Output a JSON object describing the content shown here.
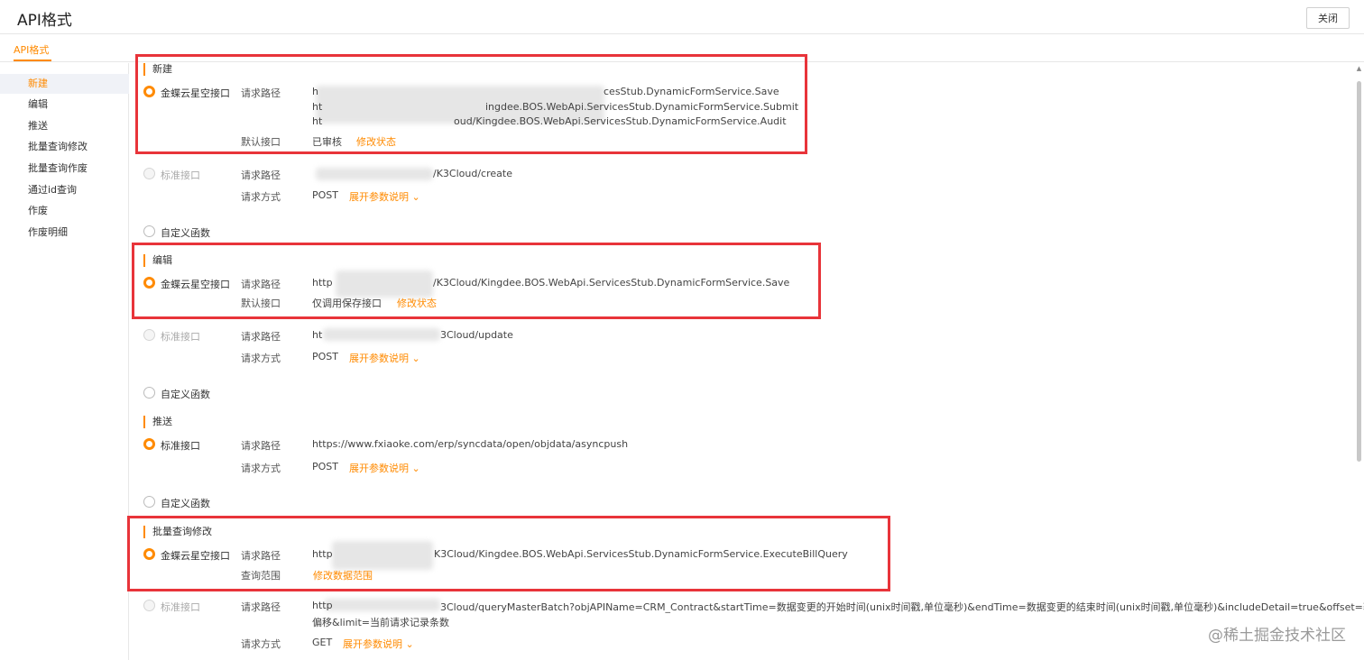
{
  "window": {
    "title": "API格式",
    "close_label": "关闭"
  },
  "tabs": [
    {
      "label": "API格式"
    }
  ],
  "sidebar": {
    "items": [
      "新建",
      "编辑",
      "推送",
      "批量查询修改",
      "批量查询作废",
      "通过id查询",
      "作废",
      "作废明细"
    ]
  },
  "labels": {
    "request_path": "请求路径",
    "default_interface": "默认接口",
    "request_method": "请求方式",
    "query_range": "查询范围",
    "modify_status": "修改状态",
    "modify_data_range": "修改数据范围",
    "expand_params": "展开参数说明",
    "custom_function": "自定义函数"
  },
  "sections": {
    "create": {
      "title": "新建",
      "kingdee_label": "金蝶云星空接口",
      "kingdee_paths": [
        "h",
        "cesStub.DynamicFormService.Save",
        "ht",
        "ingdee.BOS.WebApi.ServicesStub.DynamicFormService.Submit",
        "ht",
        "oud/Kingdee.BOS.WebApi.ServicesStub.DynamicFormService.Audit"
      ],
      "default_value": "已审核",
      "standard_label": "标准接口",
      "standard_path": "/K3Cloud/create",
      "method": "POST"
    },
    "edit": {
      "title": "编辑",
      "kingdee_label": "金蝶云星空接口",
      "kingdee_path_prefix": "http",
      "kingdee_path": "/K3Cloud/Kingdee.BOS.WebApi.ServicesStub.DynamicFormService.Save",
      "default_value": "仅调用保存接口",
      "standard_label": "标准接口",
      "standard_path_prefix": "ht",
      "standard_path": "3Cloud/update",
      "method": "POST"
    },
    "push": {
      "title": "推送",
      "standard_label": "标准接口",
      "standard_path": "https://www.fxiaoke.com/erp/syncdata/open/objdata/asyncpush",
      "method": "POST"
    },
    "batch_query": {
      "title": "批量查询修改",
      "kingdee_label": "金蝶云星空接口",
      "kingdee_path_prefix": "http",
      "kingdee_path": "K3Cloud/Kingdee.BOS.WebApi.ServicesStub.DynamicFormService.ExecuteBillQuery",
      "standard_label": "标准接口",
      "standard_path_prefix": "http",
      "standard_path_line1": "3Cloud/queryMasterBatch?objAPIName=CRM_Contract&startTime=数据变更的开始时间(unix时间戳,单位毫秒)&endTime=数据变更的结束时间(unix时间戳,单位毫秒)&includeDetail=true&offset=获取记录的",
      "standard_path_line2": "偏移&limit=当前请求记录条数",
      "method": "GET"
    }
  },
  "watermark": "@稀土掘金技术社区",
  "colors": {
    "accent": "#ff8a00",
    "highlight": "#e8343a"
  }
}
